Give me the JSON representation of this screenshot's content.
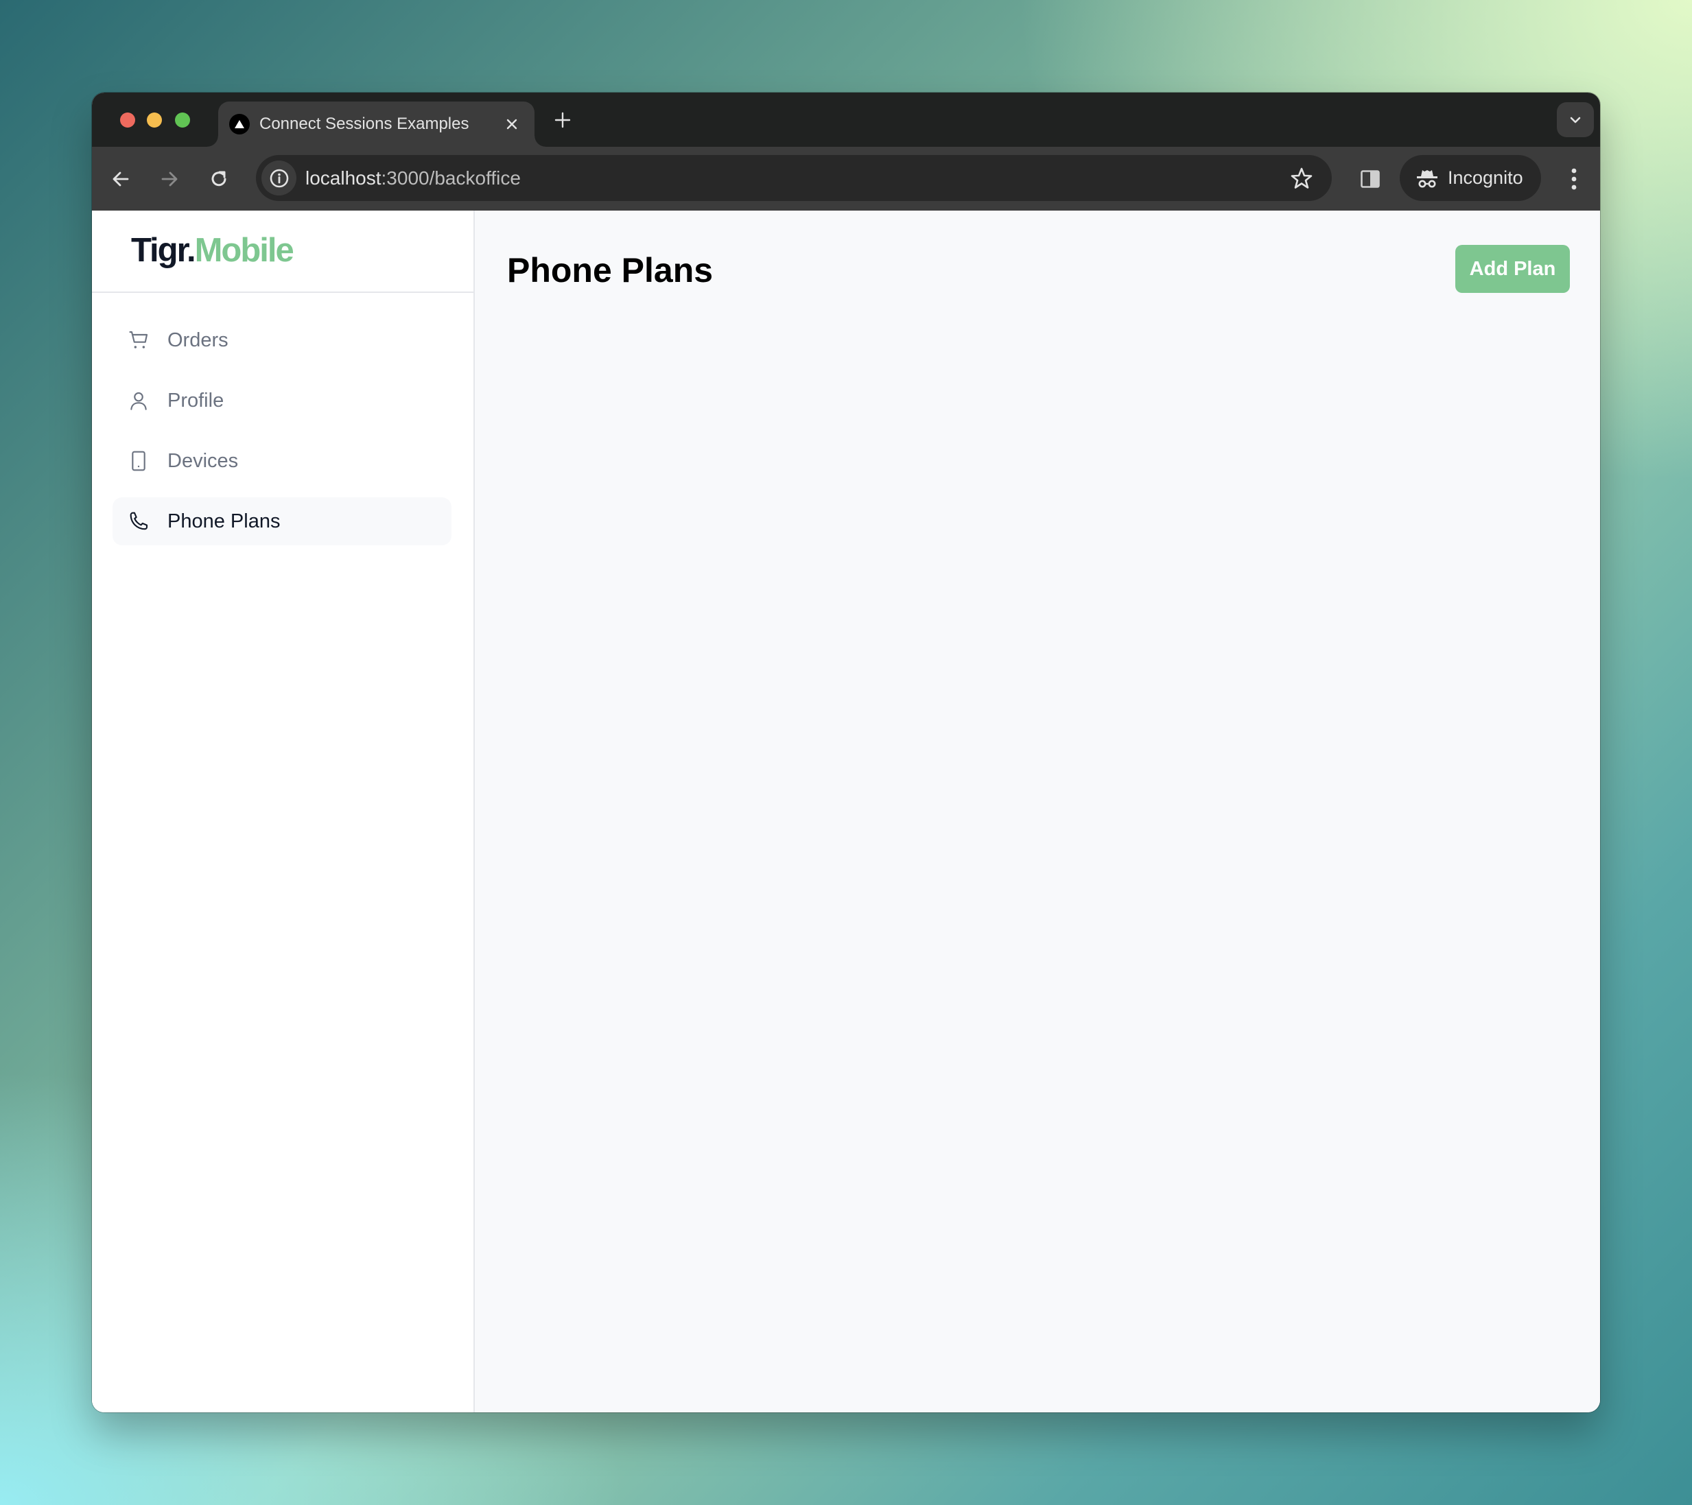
{
  "browser": {
    "tab": {
      "title": "Connect Sessions Examples",
      "favicon": "triangle-logo-icon"
    },
    "new_tab_label": "+",
    "address": {
      "host": "localhost",
      "path": ":3000/backoffice"
    },
    "incognito_label": "Incognito"
  },
  "sidebar": {
    "logo": {
      "part1": "Tigr.",
      "part2": "Mobile"
    },
    "items": [
      {
        "label": "Orders",
        "icon": "cart-icon",
        "active": false
      },
      {
        "label": "Profile",
        "icon": "user-icon",
        "active": false
      },
      {
        "label": "Devices",
        "icon": "tablet-icon",
        "active": false
      },
      {
        "label": "Phone Plans",
        "icon": "phone-icon",
        "active": true
      }
    ]
  },
  "main": {
    "title": "Phone Plans",
    "add_button_label": "Add Plan"
  },
  "colors": {
    "accent": "#7ec690",
    "text_muted": "#6b7280",
    "text_strong": "#111827"
  }
}
